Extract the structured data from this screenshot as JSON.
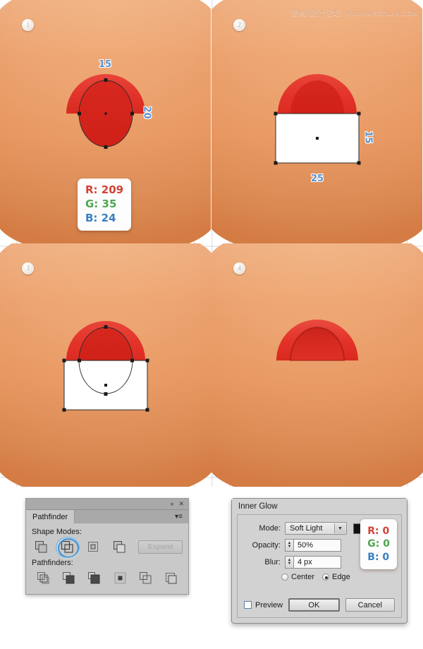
{
  "watermark": {
    "cn": "思缘设计论坛",
    "url": "WWW.MISSYUAN.COM"
  },
  "panels": [
    {
      "step": "1",
      "measurements": [
        {
          "value": "15",
          "orientation": "horizontal"
        },
        {
          "value": "20",
          "orientation": "vertical"
        }
      ]
    },
    {
      "step": "2",
      "measurements": [
        {
          "value": "15",
          "orientation": "vertical"
        },
        {
          "value": "25",
          "orientation": "horizontal"
        }
      ]
    },
    {
      "step": "3",
      "measurements": []
    },
    {
      "step": "4",
      "measurements": []
    }
  ],
  "color_tooltip_fill": {
    "r_label": "R: 209",
    "g_label": "G: 35",
    "b_label": "B: 24"
  },
  "color_tooltip_glow": {
    "r_label": "R: 0",
    "g_label": "G: 0",
    "b_label": "B: 0"
  },
  "pathfinder": {
    "tab_title": "Pathfinder",
    "collapse_icon": "«",
    "close_icon": "✕",
    "menu_icon": "▾≡",
    "shape_modes_label": "Shape Modes:",
    "pathfinders_label": "Pathfinders:",
    "expand_label": "Expand",
    "shape_modes": [
      {
        "name": "unite",
        "selected": false
      },
      {
        "name": "minus-front",
        "selected": true
      },
      {
        "name": "intersect",
        "selected": false
      },
      {
        "name": "exclude",
        "selected": false
      }
    ],
    "pathfinder_ops": [
      {
        "name": "divide"
      },
      {
        "name": "trim"
      },
      {
        "name": "merge"
      },
      {
        "name": "crop"
      },
      {
        "name": "outline"
      },
      {
        "name": "minus-back"
      }
    ]
  },
  "inner_glow": {
    "title": "Inner Glow",
    "mode_label": "Mode:",
    "mode_value": "Soft Light",
    "opacity_label": "Opacity:",
    "opacity_value": "50%",
    "blur_label": "Blur:",
    "blur_value": "4 px",
    "center_label": "Center",
    "edge_label": "Edge",
    "preview_label": "Preview",
    "ok_label": "OK",
    "cancel_label": "Cancel",
    "glow_color_hex": "#111111"
  },
  "colors": {
    "skin_light": "#f0ab76",
    "skin_dark": "#dd8147",
    "shape_red": "#e23229",
    "shape_red_dark": "#cf2118",
    "accent_blue": "#5b8fc9"
  }
}
